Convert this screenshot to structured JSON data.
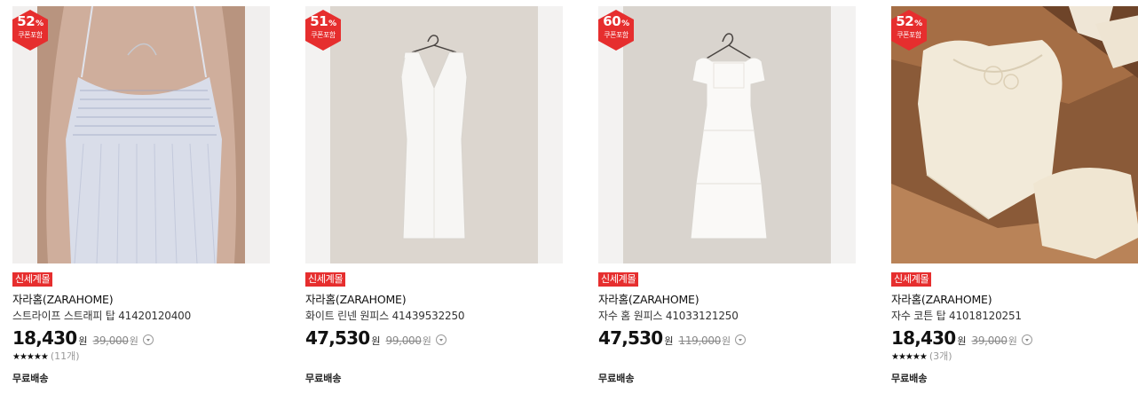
{
  "products": [
    {
      "discount": "52",
      "discount_unit": "%",
      "coupon": "쿠폰포함",
      "tag": "신세계몰",
      "brand": "자라홈(ZARAHOME)",
      "name": "스트라이프 스트래피 탑 41420120400",
      "price": "18,430",
      "price_unit": "원",
      "original_price": "39,000",
      "original_unit": "원",
      "rating_stars": "★★★★★",
      "rating_count": "(11개)",
      "shipping": "무료배송",
      "image": "striped-strappy-top-photo"
    },
    {
      "discount": "51",
      "discount_unit": "%",
      "coupon": "쿠폰포함",
      "tag": "신세계몰",
      "brand": "자라홈(ZARAHOME)",
      "name": "화이트 린넨 원피스 41439532250",
      "price": "47,530",
      "price_unit": "원",
      "original_price": "99,000",
      "original_unit": "원",
      "rating_stars": "",
      "rating_count": "",
      "shipping": "무료배송",
      "image": "white-linen-dress-photo"
    },
    {
      "discount": "60",
      "discount_unit": "%",
      "coupon": "쿠폰포함",
      "tag": "신세계몰",
      "brand": "자라홈(ZARAHOME)",
      "name": "자수 홈 원피스 41033121250",
      "price": "47,530",
      "price_unit": "원",
      "original_price": "119,000",
      "original_unit": "원",
      "rating_stars": "",
      "rating_count": "",
      "shipping": "무료배송",
      "image": "embroidered-home-dress-photo"
    },
    {
      "discount": "52",
      "discount_unit": "%",
      "coupon": "쿠폰포함",
      "tag": "신세계몰",
      "brand": "자라홈(ZARAHOME)",
      "name": "자수 코튼 탑 41018120251",
      "price": "18,430",
      "price_unit": "원",
      "original_price": "39,000",
      "original_unit": "원",
      "rating_stars": "★★★★★",
      "rating_count": "(3개)",
      "shipping": "무료배송",
      "image": "embroidered-cotton-top-photo"
    }
  ],
  "colors": {
    "badge": "#e62e2e",
    "tag": "#e62e2e"
  }
}
